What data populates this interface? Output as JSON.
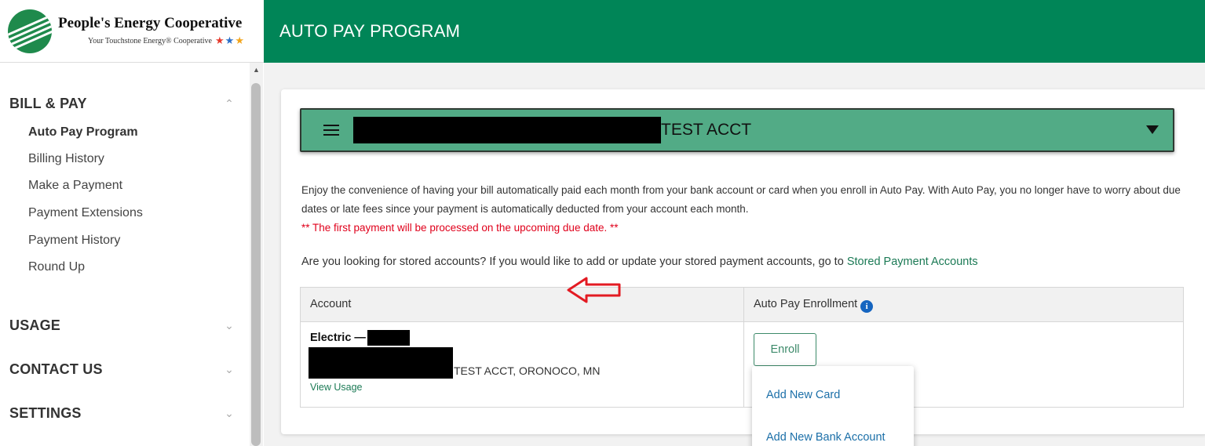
{
  "brand": {
    "name": "People's Energy Cooperative",
    "tagline": "Your Touchstone Energy® Cooperative"
  },
  "header": {
    "title": "AUTO PAY PROGRAM"
  },
  "sidebar": {
    "sections": [
      {
        "label": "BILL & PAY",
        "expanded": true,
        "icon": "chevron-up-icon"
      },
      {
        "label": "USAGE",
        "expanded": false,
        "icon": "chevron-down-icon"
      },
      {
        "label": "CONTACT US",
        "expanded": false,
        "icon": "chevron-down-icon"
      },
      {
        "label": "SETTINGS",
        "expanded": false,
        "icon": "chevron-down-icon"
      }
    ],
    "bill_pay_items": [
      {
        "label": "Auto Pay Program",
        "active": true
      },
      {
        "label": "Billing History"
      },
      {
        "label": "Make a Payment"
      },
      {
        "label": "Payment Extensions"
      },
      {
        "label": "Payment History"
      },
      {
        "label": "Round Up"
      }
    ]
  },
  "account_selector": {
    "name": "TEST ACCT",
    "menu_icon": "hamburger-icon",
    "dropdown_icon": "caret-down-icon"
  },
  "content": {
    "description": "Enjoy the convenience of having your bill automatically paid each month from your bank account or card when you enroll in Auto Pay. With Auto Pay, you no longer have to worry about due dates or late fees since your payment is automatically deducted from your account each month.",
    "notice": "** The first payment will be processed on the upcoming due date. **",
    "stored_text": "Are you looking for stored accounts? If you would like to add or update your stored payment accounts, go to",
    "stored_link": "Stored Payment Accounts"
  },
  "table": {
    "headers": [
      "Account",
      "Auto Pay Enrollment"
    ],
    "rows": [
      {
        "service": "Electric —",
        "address": "TEST ACCT, ORONOCO, MN",
        "view_usage": "View Usage",
        "enroll_label": "Enroll"
      }
    ]
  },
  "enroll_menu": {
    "items": [
      "Add New Card",
      "Add New Bank Account"
    ]
  },
  "colors": {
    "header_green": "#008557",
    "account_bar": "#52ab86",
    "link_green": "#1b7a55",
    "notice_red": "#e0001b",
    "arrow_red": "#e31b23",
    "menu_link": "#1b6fa8"
  }
}
